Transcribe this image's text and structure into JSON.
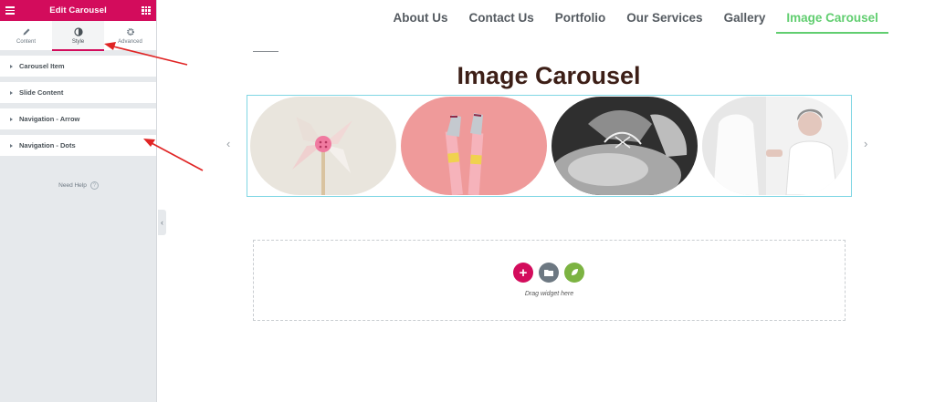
{
  "panel": {
    "title": "Edit Carousel",
    "tabs": [
      {
        "label": "Content",
        "icon": "pencil-icon"
      },
      {
        "label": "Style",
        "icon": "contrast-icon"
      },
      {
        "label": "Advanced",
        "icon": "gear-icon"
      }
    ],
    "active_tab": "Style",
    "sections": [
      {
        "label": "Carousel Item"
      },
      {
        "label": "Slide Content"
      },
      {
        "label": "Navigation - Arrow"
      },
      {
        "label": "Navigation - Dots"
      }
    ],
    "need_help": "Need Help",
    "help_glyph": "?"
  },
  "nav": {
    "items": [
      {
        "label": "About Us"
      },
      {
        "label": "Contact Us"
      },
      {
        "label": "Portfolio"
      },
      {
        "label": "Our Services"
      },
      {
        "label": "Gallery"
      },
      {
        "label": "Image Carousel"
      }
    ],
    "active": "Image Carousel"
  },
  "page": {
    "title": "Image Carousel"
  },
  "carousel": {
    "prev_glyph": "‹",
    "next_glyph": "›",
    "slides": [
      {
        "subject": "pinwheel-photo"
      },
      {
        "subject": "legs-sneakers-photo"
      },
      {
        "subject": "shoelace-photo"
      },
      {
        "subject": "fashion-model-photo"
      }
    ]
  },
  "drop_area": {
    "add_glyph": "+",
    "text": "Drag widget here"
  },
  "colors": {
    "brand": "#d30c5c",
    "nav_active": "#61ce70",
    "title": "#3d1f17",
    "annotation_arrow": "#e02424"
  }
}
